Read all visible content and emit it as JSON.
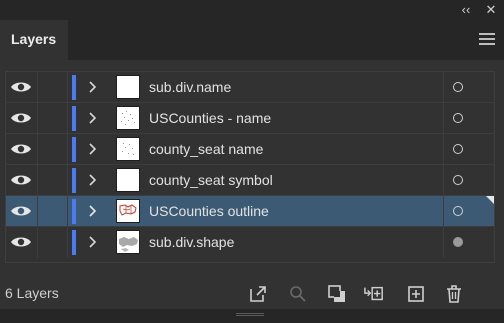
{
  "window": {
    "collapse_glyph": "‹‹",
    "close_glyph": "✕"
  },
  "panel": {
    "tab_label": "Layers"
  },
  "layers": [
    {
      "name": "sub.div.name",
      "thumb": "blank",
      "selected": false,
      "target_filled": false
    },
    {
      "name": "USCounties - name",
      "thumb": "dots",
      "selected": false,
      "target_filled": false
    },
    {
      "name": "county_seat name",
      "thumb": "dots",
      "selected": false,
      "target_filled": false
    },
    {
      "name": "county_seat symbol",
      "thumb": "blank",
      "selected": false,
      "target_filled": false
    },
    {
      "name": "USCounties outline",
      "thumb": "red-outline",
      "selected": true,
      "target_filled": false
    },
    {
      "name": "sub.div.shape",
      "thumb": "gray-shape",
      "selected": false,
      "target_filled": true
    }
  ],
  "layer_color": "#4a7bf0",
  "selection_color": "#3d5a74",
  "footer": {
    "count_label": "6 Layers",
    "icons": [
      "export-icon",
      "search-icon",
      "clipping-mask-icon",
      "new-sublayer-icon",
      "new-layer-icon",
      "delete-icon"
    ]
  }
}
